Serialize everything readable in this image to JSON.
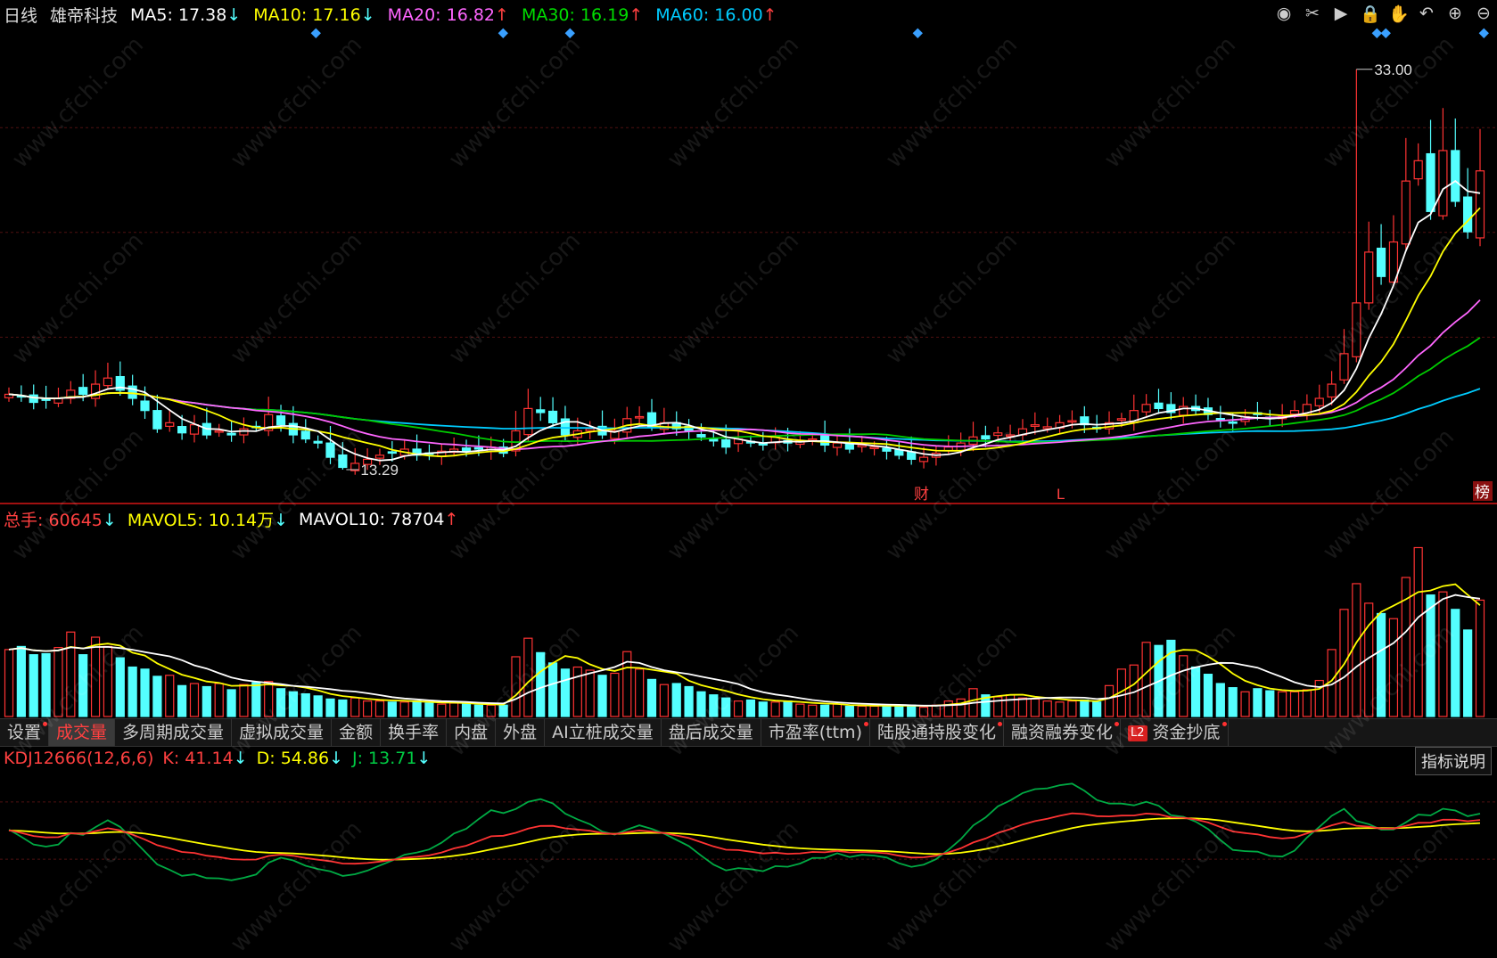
{
  "header": {
    "period": "日线",
    "stock_name": "雄帝科技",
    "ma_items": [
      {
        "label": "MA5: 17.38",
        "arrow": "↓",
        "color": "#ffffff"
      },
      {
        "label": "MA10: 17.16",
        "arrow": "↓",
        "color": "#ffff00"
      },
      {
        "label": "MA20: 16.82",
        "arrow": "↑",
        "color": "#ff66ff"
      },
      {
        "label": "MA30: 16.19",
        "arrow": "↑",
        "color": "#00dd00"
      },
      {
        "label": "MA60: 16.00",
        "arrow": "↑",
        "color": "#00ccff"
      }
    ]
  },
  "toolbar_icons": [
    "eye-icon",
    "scissors-icon",
    "play-icon",
    "lock-icon",
    "hand-icon",
    "undo-icon",
    "zoom-in-icon",
    "zoom-out-icon"
  ],
  "toolbar_glyphs": [
    "◉",
    "✂",
    "▶",
    "🔒",
    "✋",
    "↶",
    "⊕",
    "⊖"
  ],
  "price_annotations": {
    "high": "33.00",
    "low": "13.29",
    "marker_cai": "财",
    "marker_l": "L",
    "marker_bang": "榜"
  },
  "volume_legend": {
    "total_label": "总手: 60645",
    "total_arrow": "↓",
    "mavol5_label": "MAVOL5: 10.14万",
    "mavol5_arrow": "↓",
    "mavol10_label": "MAVOL10: 78704",
    "mavol10_arrow": "↑"
  },
  "tabs": [
    {
      "label": "设置",
      "dot": true
    },
    {
      "label": "成交量",
      "active": true
    },
    {
      "label": "多周期成交量"
    },
    {
      "label": "虚拟成交量"
    },
    {
      "label": "金额"
    },
    {
      "label": "换手率"
    },
    {
      "label": "内盘"
    },
    {
      "label": "外盘"
    },
    {
      "label": "AI立桩成交量"
    },
    {
      "label": "盘后成交量"
    },
    {
      "label": "市盈率(ttm)",
      "dot": true
    },
    {
      "label": "陆股通持股变化",
      "dot": true
    },
    {
      "label": "融资融券变化",
      "dot": true
    },
    {
      "label": "资金抄底",
      "l2": "L2",
      "dot": true
    }
  ],
  "kdj_legend": {
    "name": "KDJ12666(12,6,6)",
    "k_label": "K: 41.14",
    "k_arrow": "↓",
    "d_label": "D: 54.86",
    "d_arrow": "↓",
    "j_label": "J: 13.71",
    "j_arrow": "↓"
  },
  "explain_button": "指标说明",
  "watermark": "www.cfchi.com",
  "colors": {
    "up": "#ff3333",
    "down": "#54ffff",
    "ma5": "#ffffff",
    "ma10": "#ffff00",
    "ma20": "#ff66ff",
    "ma30": "#00cc00",
    "ma60": "#00ccff",
    "k": "#ff3333",
    "d": "#ffff00",
    "j": "#00aa44"
  },
  "chart_data": {
    "type": "candlestick",
    "price_high": 33.0,
    "price_low": 13.29,
    "closes": [
      17.0,
      16.9,
      16.6,
      16.7,
      16.8,
      17.2,
      17.0,
      17.5,
      17.8,
      17.2,
      16.8,
      16.2,
      15.3,
      15.6,
      15.1,
      15.5,
      15.0,
      15.2,
      15.0,
      15.3,
      15.4,
      16.0,
      15.5,
      15.0,
      14.8,
      14.6,
      13.9,
      13.4,
      13.6,
      13.8,
      14.0,
      14.1,
      14.3,
      14.0,
      14.1,
      14.2,
      14.3,
      14.2,
      14.3,
      14.4,
      14.1,
      15.2,
      16.3,
      16.1,
      15.6,
      15.0,
      15.2,
      15.3,
      15.0,
      15.2,
      15.8,
      15.9,
      15.4,
      15.6,
      15.3,
      15.2,
      14.9,
      14.7,
      14.4,
      14.8,
      14.6,
      14.5,
      14.9,
      14.6,
      14.7,
      14.8,
      14.5,
      14.6,
      14.3,
      14.5,
      14.4,
      14.2,
      14.0,
      13.8,
      13.9,
      14.1,
      14.4,
      14.6,
      14.9,
      14.8,
      15.1,
      15.0,
      15.3,
      15.5,
      15.4,
      15.6,
      15.7,
      15.5,
      15.3,
      15.6,
      15.8,
      16.2,
      16.5,
      16.3,
      16.1,
      16.4,
      16.2,
      16.0,
      15.7,
      15.6,
      15.9,
      16.0,
      15.8,
      15.9,
      16.2,
      16.5,
      16.8,
      17.5,
      19.0,
      21.5,
      24.0,
      22.8,
      24.5,
      27.5,
      28.5,
      26.0,
      29.0,
      26.5,
      25.0,
      28.0
    ],
    "volumes": [
      6.5,
      6.8,
      6.0,
      6.1,
      6.7,
      8.2,
      6.0,
      7.7,
      6.8,
      5.7,
      4.8,
      4.6,
      3.9,
      4.0,
      3.0,
      3.2,
      2.9,
      3.2,
      2.6,
      3.1,
      3.3,
      3.4,
      2.7,
      2.4,
      2.2,
      2.0,
      1.7,
      1.6,
      1.8,
      1.5,
      1.5,
      1.4,
      1.4,
      1.5,
      1.3,
      1.2,
      1.3,
      1.2,
      1.1,
      1.1,
      1.1,
      5.8,
      7.6,
      6.2,
      5.2,
      4.6,
      4.8,
      4.5,
      4.0,
      4.2,
      6.3,
      4.6,
      3.6,
      3.1,
      3.2,
      2.9,
      2.4,
      2.1,
      1.8,
      1.5,
      1.6,
      1.4,
      1.4,
      1.5,
      1.2,
      1.1,
      1.1,
      1.2,
      1.0,
      1.0,
      1.0,
      1.1,
      1.1,
      1.1,
      0.9,
      1.1,
      1.5,
      1.7,
      2.7,
      2.1,
      1.9,
      2.1,
      1.8,
      1.7,
      1.5,
      1.4,
      1.5,
      1.6,
      1.4,
      3.0,
      4.6,
      5.0,
      7.2,
      6.9,
      7.4,
      5.9,
      4.8,
      4.1,
      3.2,
      2.8,
      2.4,
      2.7,
      2.5,
      2.4,
      2.4,
      2.6,
      3.5,
      6.5,
      10.4,
      12.9,
      11.0,
      10.0,
      9.5,
      13.5,
      16.4,
      11.8,
      12.1,
      10.4,
      8.4,
      11.3
    ]
  }
}
